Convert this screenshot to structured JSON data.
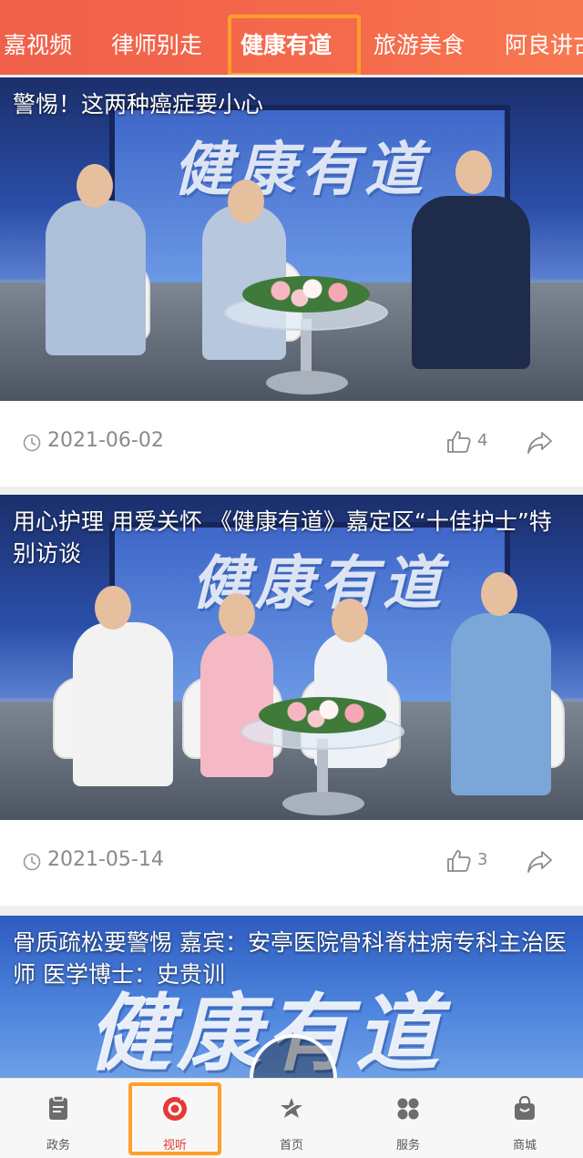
{
  "top_tabs": [
    "嘉视频",
    "律师别走",
    "健康有道",
    "旅游美食",
    "阿良讲古"
  ],
  "active_tab_index": 2,
  "cards": [
    {
      "title": "警惕！这两种癌症要小心",
      "banner_text": "健康有道",
      "date": "2021-06-02",
      "likes": "4"
    },
    {
      "title": "用心护理 用爱关怀 《健康有道》嘉定区“十佳护士”特别访谈",
      "banner_text": "健康有道",
      "date": "2021-05-14",
      "likes": "3"
    },
    {
      "title": "骨质疏松要警惕 嘉宾：安亭医院骨科脊柱病专科主治医师 医学博士：史贵训",
      "banner_text": "健康有道"
    }
  ],
  "bottom_nav": [
    {
      "label": "政务",
      "icon": "document-icon"
    },
    {
      "label": "视听",
      "icon": "play-circle-icon"
    },
    {
      "label": "首页",
      "icon": "star-swoosh-icon"
    },
    {
      "label": "服务",
      "icon": "grid-icon"
    },
    {
      "label": "商城",
      "icon": "shopping-bag-icon"
    }
  ],
  "active_nav_index": 1,
  "colors": {
    "accent": "#e53935",
    "tab_gradient_start": "#f0604a",
    "highlight_outline": "#ff9f2a"
  }
}
